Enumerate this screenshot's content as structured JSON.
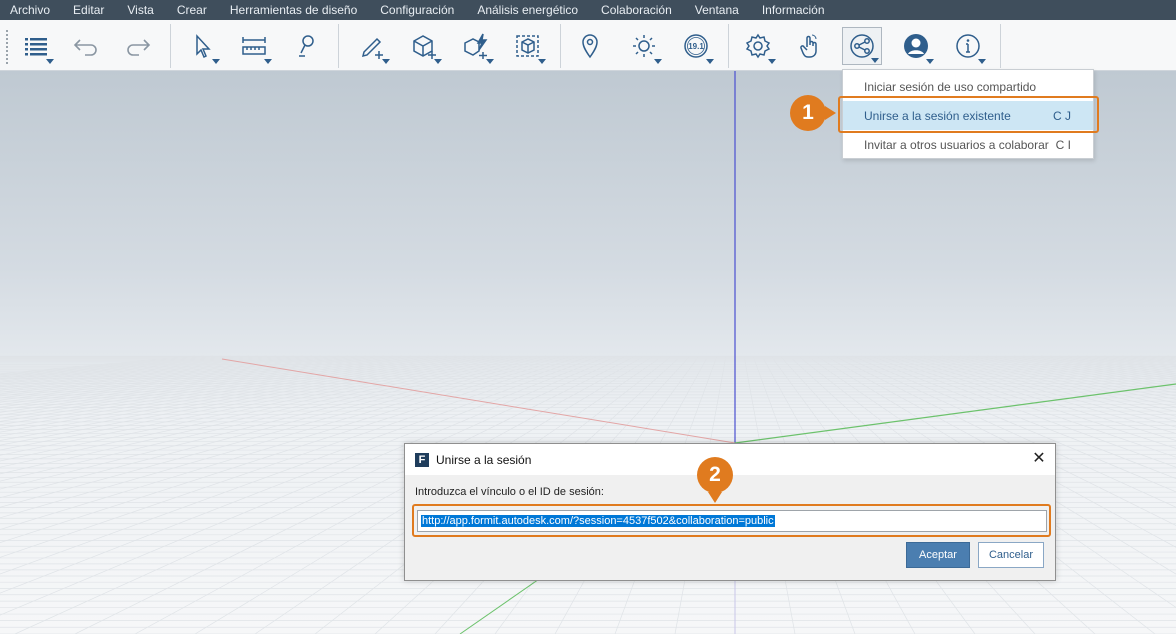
{
  "menubar": {
    "items": [
      "Archivo",
      "Editar",
      "Vista",
      "Crear",
      "Herramientas de diseño",
      "Configuración",
      "Análisis energético",
      "Colaboración",
      "Ventana",
      "Información"
    ]
  },
  "toolbar": {
    "sun_badge": "19.1"
  },
  "dropdown": {
    "items": [
      {
        "label": "Iniciar sesión de uso compartido",
        "shortcut": ""
      },
      {
        "label": "Unirse a la sesión existente",
        "shortcut": "C J"
      },
      {
        "label": "Invitar a otros usuarios a colaborar",
        "shortcut": "C I"
      }
    ]
  },
  "callouts": {
    "one": "1",
    "two": "2"
  },
  "dialog": {
    "logo": "F",
    "title": "Unirse a la sesión",
    "close": "✕",
    "label": "Introduzca el vínculo o el ID de sesión:",
    "input_value": "http://app.formit.autodesk.com/?session=4537f502&collaboration=public",
    "ok_label": "Aceptar",
    "cancel_label": "Cancelar"
  },
  "colors": {
    "menubar_bg": "#3f4e5c",
    "accent": "#2f5e8c",
    "callout": "#e07b1f",
    "selection": "#cde6f4"
  }
}
